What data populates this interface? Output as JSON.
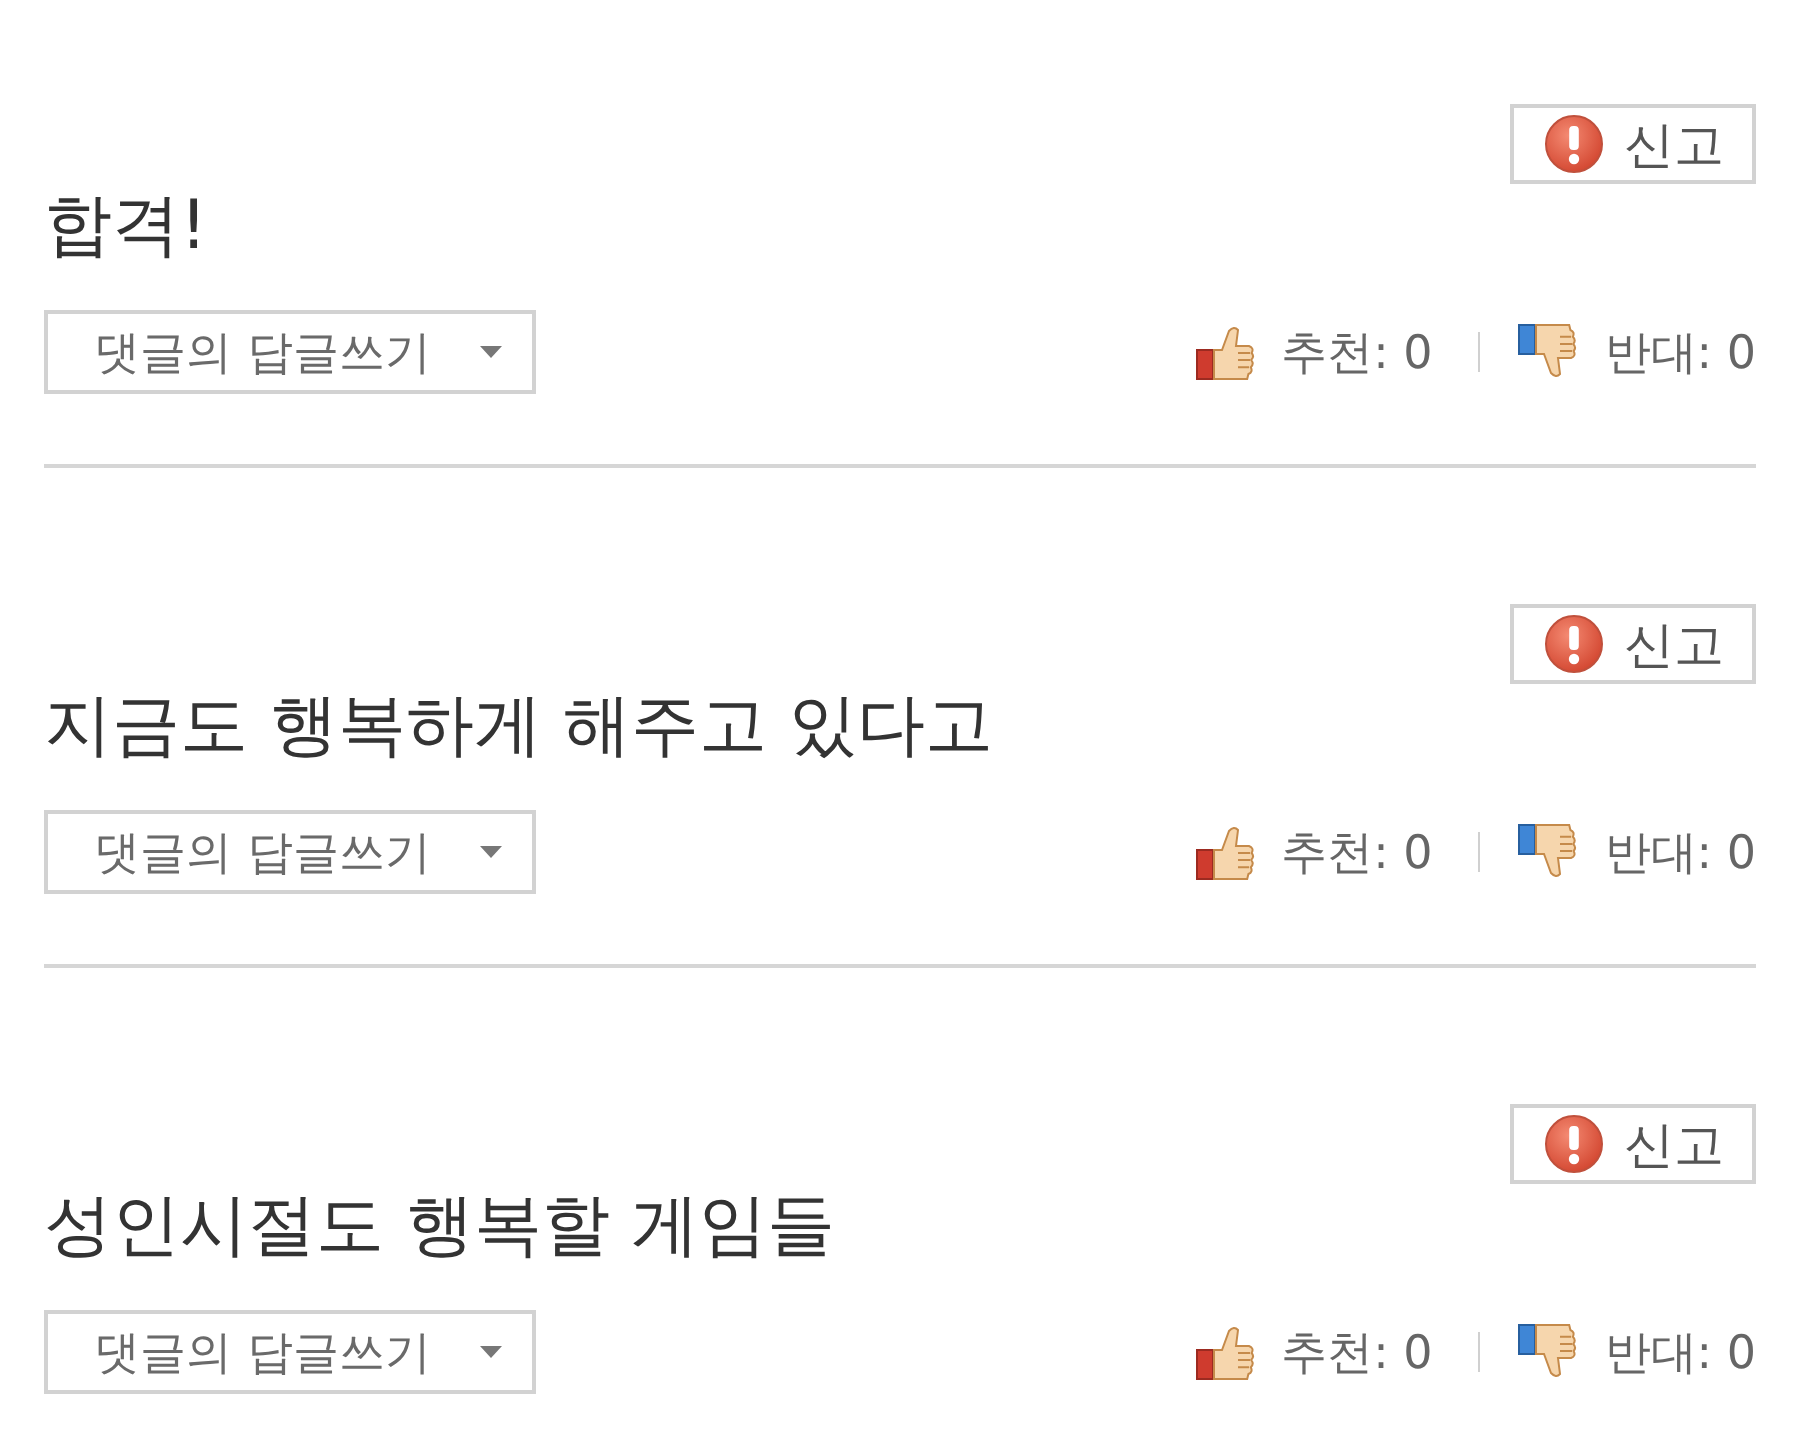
{
  "comments": [
    {
      "report_button": {
        "label": "신고"
      },
      "text": "합격!",
      "reply_button": {
        "label": "댓글의 답글쓰기"
      },
      "votes": {
        "recommend": "추천: 0",
        "oppose": "반대: 0"
      }
    },
    {
      "report_button": {
        "label": "신고"
      },
      "text": "지금도 행복하게 해주고 있다고",
      "reply_button": {
        "label": "댓글의 답글쓰기"
      },
      "votes": {
        "recommend": "추천: 0",
        "oppose": "반대: 0"
      }
    },
    {
      "report_button": {
        "label": "신고"
      },
      "text": "성인시절도 행복할 게임들",
      "reply_button": {
        "label": "댓글의 답글쓰기"
      },
      "votes": {
        "recommend": "추천: 0",
        "oppose": "반대: 0"
      }
    }
  ]
}
